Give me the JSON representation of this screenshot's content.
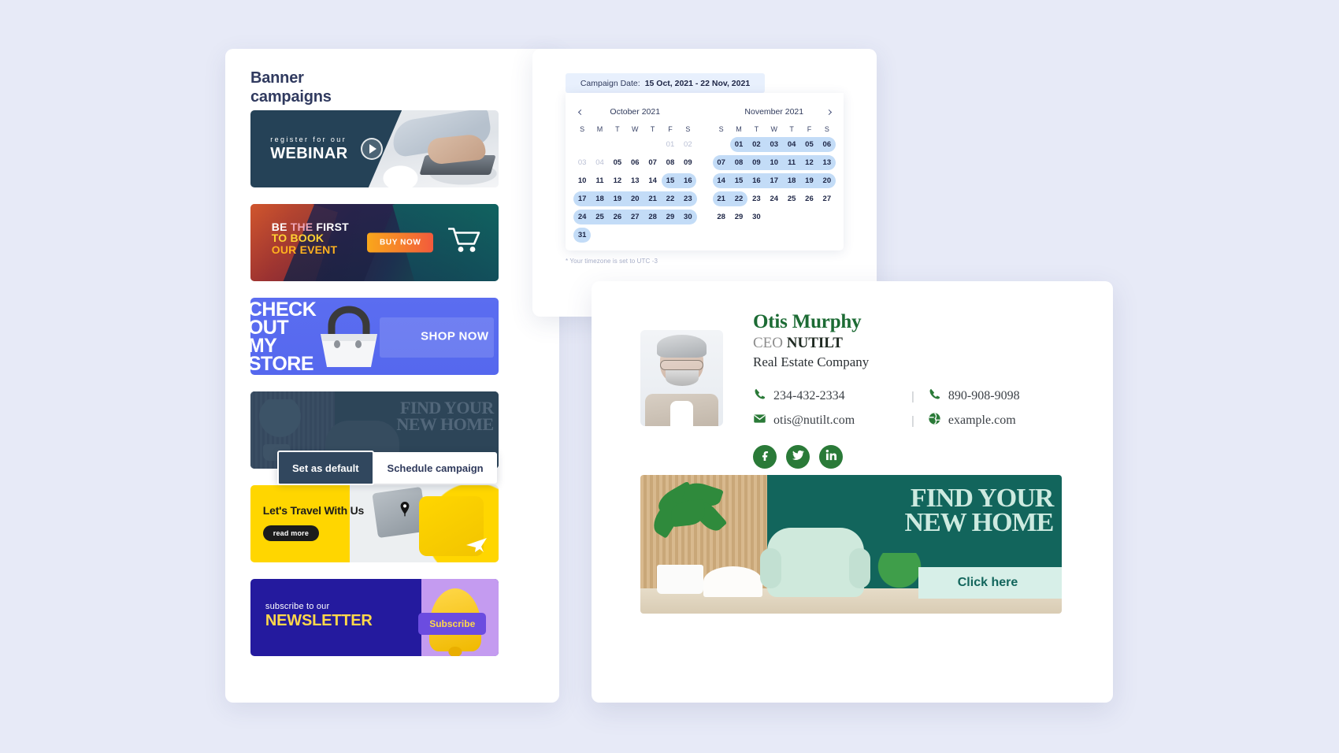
{
  "theme": {
    "page_bg": "#e7eaf7",
    "card_bg": "#ffffff",
    "accent_navy": "#303a5f",
    "calendar_highlight": "#c3dcf7",
    "calendar_header_bg": "#e8f0fd",
    "brand_green": "#1c6b34",
    "social_green": "#2a7a38",
    "banner_teal": "#12655c"
  },
  "left_panel": {
    "title_line1": "Banner",
    "title_line2": "campaigns",
    "banners": [
      {
        "id": "webinar",
        "name": "webinar-banner",
        "small_text": "register for our",
        "large_text": "WEBINAR",
        "has_play_button": true,
        "play_icon": "play-icon"
      },
      {
        "id": "event",
        "name": "event-banner",
        "line1_word1": "BE",
        "line1_word2": "THE",
        "line1_word3": "FIRST",
        "line2": "TO BOOK",
        "line3": "OUR EVENT",
        "cta": "BUY NOW",
        "icon": "shopping-cart-icon"
      },
      {
        "id": "store",
        "name": "store-banner",
        "headline": "CHECK\nOUT\nMY\nSTORE",
        "cta": "SHOP NOW",
        "icon": "shopping-basket-icon"
      },
      {
        "id": "home",
        "name": "find-new-home-banner",
        "headline_line1": "FIND YOUR",
        "headline_line2": "NEW HOME",
        "selected": true
      },
      {
        "id": "travel",
        "name": "travel-banner",
        "headline": "Let's Travel With Us",
        "cta": "read more",
        "icon": "location-pin-icon"
      },
      {
        "id": "newsletter",
        "name": "newsletter-banner",
        "small_text": "subscribe to our",
        "large_text": "NEWSLETTER",
        "cta": "Subscribe",
        "icon": "bell-icon"
      }
    ],
    "selected_overlay": {
      "primary_button": "Set as default",
      "secondary_button": "Schedule campaign"
    }
  },
  "calendar": {
    "header_label": "Campaign Date:",
    "header_value": "15 Oct, 2021 - 22 Nov, 2021",
    "prev_icon": "chevron-left-icon",
    "next_icon": "chevron-right-icon",
    "timezone_note": "* Your timezone is set to UTC -3",
    "weekday_labels": [
      "S",
      "M",
      "T",
      "W",
      "T",
      "F",
      "S"
    ],
    "months": [
      {
        "title": "October 2021",
        "weeks": [
          [
            {
              "d": "",
              "t": "empty"
            },
            {
              "d": "",
              "t": "empty"
            },
            {
              "d": "",
              "t": "empty"
            },
            {
              "d": "",
              "t": "empty"
            },
            {
              "d": "",
              "t": "empty"
            },
            {
              "d": "01",
              "t": "muted"
            },
            {
              "d": "02",
              "t": "muted"
            }
          ],
          [
            {
              "d": "03",
              "t": "muted"
            },
            {
              "d": "04",
              "t": "muted"
            },
            {
              "d": "05",
              "t": "today"
            },
            {
              "d": "06",
              "t": "normal"
            },
            {
              "d": "07",
              "t": "normal"
            },
            {
              "d": "08",
              "t": "normal"
            },
            {
              "d": "09",
              "t": "normal"
            }
          ],
          [
            {
              "d": "10",
              "t": "normal"
            },
            {
              "d": "11",
              "t": "normal"
            },
            {
              "d": "12",
              "t": "normal"
            },
            {
              "d": "13",
              "t": "normal"
            },
            {
              "d": "14",
              "t": "normal"
            },
            {
              "d": "15",
              "t": "sel-start"
            },
            {
              "d": "16",
              "t": "sel-end"
            }
          ],
          [
            {
              "d": "17",
              "t": "sel-start"
            },
            {
              "d": "18",
              "t": "sel"
            },
            {
              "d": "19",
              "t": "sel"
            },
            {
              "d": "20",
              "t": "sel"
            },
            {
              "d": "21",
              "t": "sel"
            },
            {
              "d": "22",
              "t": "sel"
            },
            {
              "d": "23",
              "t": "sel-end"
            }
          ],
          [
            {
              "d": "24",
              "t": "sel-start"
            },
            {
              "d": "25",
              "t": "sel"
            },
            {
              "d": "26",
              "t": "sel"
            },
            {
              "d": "27",
              "t": "sel"
            },
            {
              "d": "28",
              "t": "sel"
            },
            {
              "d": "29",
              "t": "sel"
            },
            {
              "d": "30",
              "t": "sel-end"
            }
          ],
          [
            {
              "d": "31",
              "t": "sel-single"
            },
            {
              "d": "",
              "t": "empty"
            },
            {
              "d": "",
              "t": "empty"
            },
            {
              "d": "",
              "t": "empty"
            },
            {
              "d": "",
              "t": "empty"
            },
            {
              "d": "",
              "t": "empty"
            },
            {
              "d": "",
              "t": "empty"
            }
          ]
        ],
        "ranges": [
          {
            "week": 2,
            "from": 5,
            "to": 6
          },
          {
            "week": 3,
            "from": 0,
            "to": 6
          },
          {
            "week": 4,
            "from": 0,
            "to": 6
          },
          {
            "week": 5,
            "from": 0,
            "to": 0
          }
        ]
      },
      {
        "title": "November 2021",
        "weeks": [
          [
            {
              "d": "",
              "t": "empty"
            },
            {
              "d": "01",
              "t": "sel-start"
            },
            {
              "d": "02",
              "t": "sel"
            },
            {
              "d": "03",
              "t": "sel"
            },
            {
              "d": "04",
              "t": "sel"
            },
            {
              "d": "05",
              "t": "sel"
            },
            {
              "d": "06",
              "t": "sel-end"
            }
          ],
          [
            {
              "d": "07",
              "t": "sel-start"
            },
            {
              "d": "08",
              "t": "sel"
            },
            {
              "d": "09",
              "t": "sel"
            },
            {
              "d": "10",
              "t": "sel"
            },
            {
              "d": "11",
              "t": "sel"
            },
            {
              "d": "12",
              "t": "sel"
            },
            {
              "d": "13",
              "t": "sel-end"
            }
          ],
          [
            {
              "d": "14",
              "t": "sel-start"
            },
            {
              "d": "15",
              "t": "sel"
            },
            {
              "d": "16",
              "t": "sel"
            },
            {
              "d": "17",
              "t": "sel"
            },
            {
              "d": "18",
              "t": "sel"
            },
            {
              "d": "19",
              "t": "sel"
            },
            {
              "d": "20",
              "t": "sel-end"
            }
          ],
          [
            {
              "d": "21",
              "t": "sel-start"
            },
            {
              "d": "22",
              "t": "sel-end"
            },
            {
              "d": "23",
              "t": "normal"
            },
            {
              "d": "24",
              "t": "normal"
            },
            {
              "d": "25",
              "t": "normal"
            },
            {
              "d": "26",
              "t": "normal"
            },
            {
              "d": "27",
              "t": "normal"
            }
          ],
          [
            {
              "d": "28",
              "t": "normal"
            },
            {
              "d": "29",
              "t": "normal"
            },
            {
              "d": "30",
              "t": "normal"
            },
            {
              "d": "",
              "t": "empty"
            },
            {
              "d": "",
              "t": "empty"
            },
            {
              "d": "",
              "t": "empty"
            },
            {
              "d": "",
              "t": "empty"
            }
          ],
          [
            {
              "d": "",
              "t": "empty"
            },
            {
              "d": "",
              "t": "empty"
            },
            {
              "d": "",
              "t": "empty"
            },
            {
              "d": "",
              "t": "empty"
            },
            {
              "d": "",
              "t": "empty"
            },
            {
              "d": "",
              "t": "empty"
            },
            {
              "d": "",
              "t": "empty"
            }
          ]
        ],
        "ranges": [
          {
            "week": 0,
            "from": 1,
            "to": 6
          },
          {
            "week": 1,
            "from": 0,
            "to": 6
          },
          {
            "week": 2,
            "from": 0,
            "to": 6
          },
          {
            "week": 3,
            "from": 0,
            "to": 1
          }
        ]
      }
    ]
  },
  "profile": {
    "avatar_name": "profile-photo",
    "name": "Otis Murphy",
    "role_prefix": "CEO ",
    "role_company": "NUTILT",
    "company_type": "Real Estate Company",
    "contacts": [
      {
        "icon": "phone-icon",
        "value": "234-432-2334",
        "name": "phone-primary"
      },
      {
        "icon": "phone-icon",
        "value": "890-908-9098",
        "name": "phone-secondary"
      },
      {
        "icon": "envelope-icon",
        "value": "otis@nutilt.com",
        "name": "email"
      },
      {
        "icon": "globe-icon",
        "value": "example.com",
        "name": "website"
      }
    ],
    "divider": "|",
    "socials": [
      {
        "icon": "facebook-icon",
        "name": "social-facebook"
      },
      {
        "icon": "twitter-icon",
        "name": "social-twitter"
      },
      {
        "icon": "linkedin-icon",
        "name": "social-linkedin"
      }
    ],
    "signature_banner": {
      "headline_line1": "FIND YOUR",
      "headline_line2": "NEW HOME",
      "cta": "Click here"
    }
  }
}
